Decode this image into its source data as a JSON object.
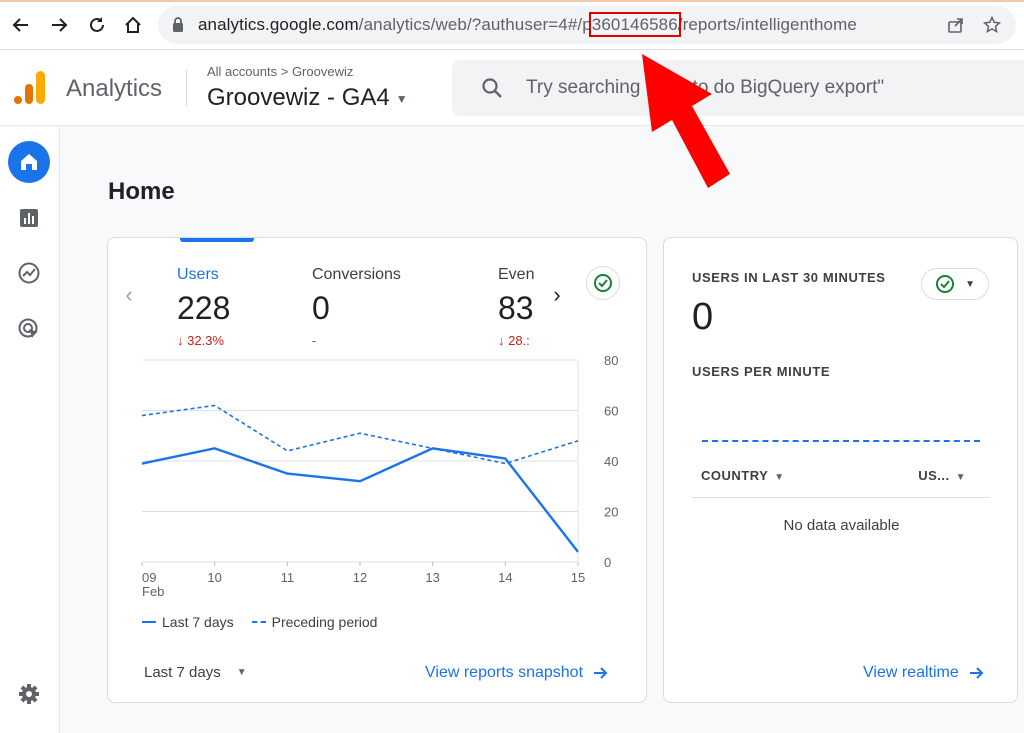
{
  "browser": {
    "url_host": "analytics.google.com",
    "url_path_a": "/analytics/web/?authuser=4#/p",
    "url_highlight": "360146586",
    "url_path_b": "/reports/intelligenthome"
  },
  "header": {
    "app_name": "Analytics",
    "breadcrumb_all": "All accounts",
    "breadcrumb_sep": ">",
    "breadcrumb_account": "Groovewiz",
    "property": "Groovewiz - GA4",
    "search_placeholder": "Try searching \"how to do BigQuery export\""
  },
  "page": {
    "title": "Home"
  },
  "metrics": [
    {
      "label": "Users",
      "value": "228",
      "delta": "↓ 32.3%"
    },
    {
      "label": "Conversions",
      "value": "0",
      "delta": "-"
    },
    {
      "label": "Even",
      "value": "83",
      "delta": "↓ 28.:"
    }
  ],
  "chart_data": {
    "type": "line",
    "x": [
      "09",
      "10",
      "11",
      "12",
      "13",
      "14",
      "15"
    ],
    "x_sub": "Feb",
    "y_ticks": [
      "80",
      "60",
      "40",
      "20",
      "0"
    ],
    "ylim": [
      0,
      80
    ],
    "series": [
      {
        "name": "Last 7 days",
        "values": [
          39,
          45,
          35,
          32,
          45,
          41,
          4
        ]
      },
      {
        "name": "Preceding period",
        "values": [
          58,
          62,
          44,
          51,
          45,
          39,
          48
        ]
      }
    ]
  },
  "footer": {
    "range": "Last 7 days",
    "snapshot_link": "View reports snapshot"
  },
  "realtime": {
    "title": "USERS IN LAST 30 MINUTES",
    "value": "0",
    "per_minute": "USERS PER MINUTE",
    "col_country": "COUNTRY",
    "col_users": "US...",
    "empty": "No data available",
    "link": "View realtime"
  },
  "colors": {
    "accent": "#1a73e8",
    "negative": "#c5221f",
    "check": "#188038",
    "annotation": "#ff0000"
  }
}
